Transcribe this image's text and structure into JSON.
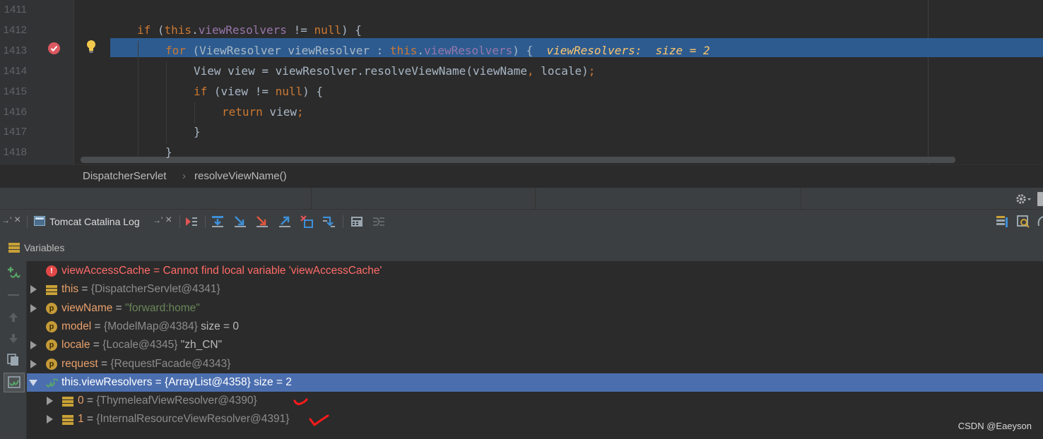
{
  "editor": {
    "line_numbers": [
      "1411",
      "1412",
      "1413",
      "1414",
      "1415",
      "1416",
      "1417",
      "1418"
    ],
    "lines": [
      {
        "tokens": []
      },
      {
        "tokens": [
          {
            "t": "if",
            "c": "kw"
          },
          {
            "t": " (",
            "c": ""
          },
          {
            "t": "this",
            "c": "kw"
          },
          {
            "t": ".",
            "c": ""
          },
          {
            "t": "viewResolvers",
            "c": "fld"
          },
          {
            "t": " != ",
            "c": ""
          },
          {
            "t": "null",
            "c": "kw"
          },
          {
            "t": ") {",
            "c": ""
          }
        ]
      },
      {
        "tokens": [
          {
            "t": "for",
            "c": "kw"
          },
          {
            "t": " (ViewResolver viewResolver : ",
            "c": ""
          },
          {
            "t": "this",
            "c": "kw"
          },
          {
            "t": ".",
            "c": ""
          },
          {
            "t": "viewResolvers",
            "c": "fld"
          },
          {
            "t": ") {  ",
            "c": ""
          },
          {
            "t": "viewResolvers:  size = 2",
            "c": "inl"
          }
        ]
      },
      {
        "tokens": [
          {
            "t": "View view = viewResolver.resolveViewName(viewName",
            "c": ""
          },
          {
            "t": ",",
            "c": "kw"
          },
          {
            "t": " locale)",
            "c": ""
          },
          {
            "t": ";",
            "c": "kw"
          }
        ]
      },
      {
        "tokens": [
          {
            "t": "if",
            "c": "kw"
          },
          {
            "t": " (view != ",
            "c": ""
          },
          {
            "t": "null",
            "c": "kw"
          },
          {
            "t": ") {",
            "c": ""
          }
        ]
      },
      {
        "tokens": [
          {
            "t": "return",
            "c": "kw"
          },
          {
            "t": " view",
            "c": ""
          },
          {
            "t": ";",
            "c": "kw"
          }
        ]
      },
      {
        "tokens": [
          {
            "t": "}",
            "c": ""
          }
        ]
      },
      {
        "tokens": [
          {
            "t": "}",
            "c": ""
          }
        ]
      }
    ]
  },
  "breadcrumb": {
    "class_name": "DispatcherServlet",
    "separator": "›",
    "method_name": "resolveViewName()"
  },
  "debug": {
    "tab_label": "Tomcat Catalina Log",
    "tab_pin_glyph": "→'",
    "close_glyph": "×",
    "variables_title": "Variables"
  },
  "variables": [
    {
      "expand": "none",
      "icon": "error-icon",
      "name": "viewAccessCache",
      "eq": " = ",
      "value": "Cannot find local variable 'viewAccessCache'",
      "value_style": "err",
      "selected": false
    },
    {
      "expand": "right",
      "icon": "object-icon",
      "name": "this",
      "eq": " = ",
      "value": "{DispatcherServlet@4341}",
      "value_style": "ref",
      "selected": false
    },
    {
      "expand": "right",
      "icon": "param-icon",
      "name": "viewName",
      "eq": " = ",
      "value": "\"forward:home\"",
      "value_style": "str",
      "selected": false
    },
    {
      "expand": "none",
      "icon": "param-icon",
      "name": "model",
      "eq": " = ",
      "value": "{ModelMap@4384}",
      "value_style": "ref",
      "extra": " size = 0",
      "selected": false
    },
    {
      "expand": "right",
      "icon": "param-icon",
      "name": "locale",
      "eq": " = ",
      "value": "{Locale@4345}",
      "value_style": "ref",
      "extra": " \"zh_CN\"",
      "selected": false
    },
    {
      "expand": "right",
      "icon": "param-icon",
      "name": "request",
      "eq": " = ",
      "value": "{RequestFacade@4343}",
      "value_style": "ref",
      "selected": false
    },
    {
      "expand": "down",
      "icon": "watch-icon",
      "name": "this.viewResolvers",
      "eq": " = ",
      "value": "{ArrayList@4358}",
      "value_style": "ref",
      "extra": " size = 2",
      "selected": true
    },
    {
      "expand": "right",
      "icon": "object-icon",
      "name": "0",
      "eq": " = ",
      "value": "{ThymeleafViewResolver@4390}",
      "value_style": "ref",
      "selected": false,
      "indent": 1
    },
    {
      "expand": "right",
      "icon": "object-icon",
      "name": "1",
      "eq": " = ",
      "value": "{InternalResourceViewResolver@4391}",
      "value_style": "ref",
      "selected": false,
      "indent": 1
    }
  ],
  "watermark": "CSDN @Eaeyson",
  "colors": {
    "keyword": "#cc7832",
    "field": "#9876aa",
    "inline_hint": "#ffc66d",
    "execution_line": "#2d5b8f",
    "selected_row": "#4b6eaf",
    "breakpoint": "#db5860",
    "annotation_red": "#ff1a1a"
  }
}
